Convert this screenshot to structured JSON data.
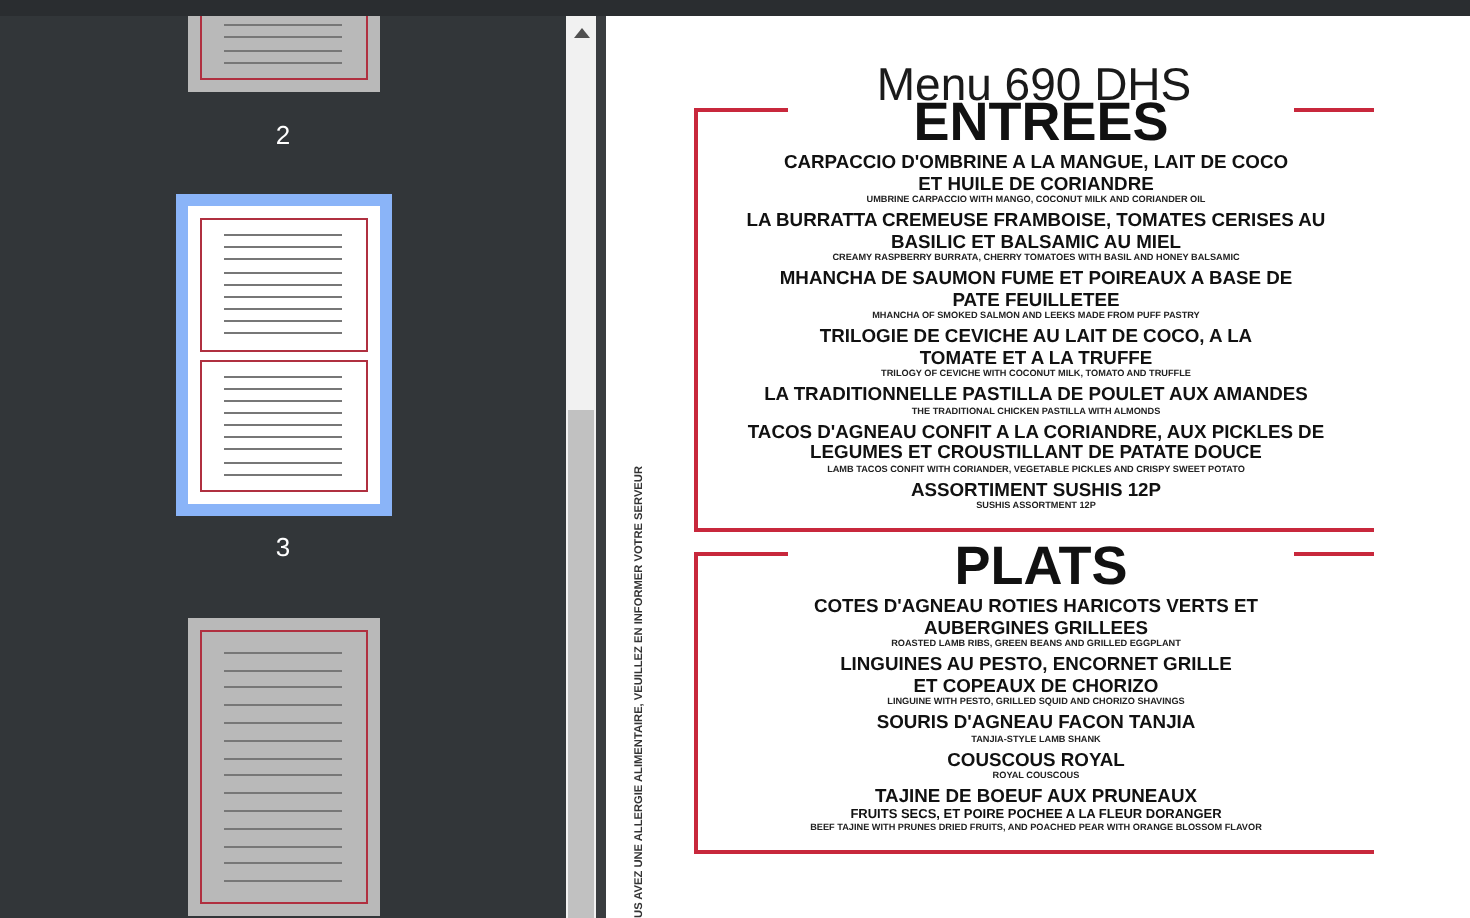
{
  "sidebar": {
    "thumbnails": [
      {
        "page_label": "2",
        "selected": false,
        "kind": "menu"
      },
      {
        "page_label": "3",
        "selected": true,
        "kind": "menu"
      },
      {
        "selected": false,
        "kind": "desserts"
      }
    ]
  },
  "page": {
    "title": "Menu 690 DHS",
    "side_note": "US AVEZ UNE ALLERGIE ALIMENTAIRE, VEUILLEZ EN INFORMER VOTRE SERVEUR",
    "sections": [
      {
        "heading": "ENTREES",
        "items": [
          {
            "name_lines": [
              "CARPACCIO D'OMBRINE A LA MANGUE, LAIT DE COCO",
              "ET HUILE DE CORIANDRE"
            ],
            "description": "UMBRINE CARPACCIO WITH MANGO, COCONUT MILK AND CORIANDER OIL"
          },
          {
            "name_lines": [
              "LA BURRATTA CREMEUSE FRAMBOISE, TOMATES CERISES AU",
              "BASILIC ET BALSAMIC AU MIEL"
            ],
            "description": "CREAMY RASPBERRY BURRATA, CHERRY TOMATOES WITH BASIL AND HONEY BALSAMIC"
          },
          {
            "name_lines": [
              "MHANCHA DE SAUMON FUME ET POIREAUX A BASE DE",
              "PATE FEUILLETEE"
            ],
            "description": "MHANCHA OF SMOKED SALMON AND LEEKS MADE FROM PUFF PASTRY"
          },
          {
            "name_lines": [
              "TRILOGIE DE CEVICHE AU LAIT DE COCO, A LA",
              "TOMATE ET A LA TRUFFE"
            ],
            "description": "TRILOGY OF CEVICHE WITH COCONUT MILK, TOMATO AND TRUFFLE"
          },
          {
            "name_lines": [
              "LA TRADITIONNELLE PASTILLA DE POULET AUX AMANDES"
            ],
            "description": "THE TRADITIONAL CHICKEN PASTILLA WITH ALMONDS"
          },
          {
            "name_lines": [
              "TACOS D'AGNEAU CONFIT A LA CORIANDRE, AUX PICKLES DE",
              "LEGUMES ET CROUSTILLANT DE PATATE DOUCE"
            ],
            "description": "LAMB TACOS CONFIT WITH CORIANDER, VEGETABLE PICKLES AND CRISPY SWEET POTATO"
          },
          {
            "name_lines": [
              "ASSORTIMENT SUSHIS 12P"
            ],
            "description": "SUSHIS ASSORTMENT 12P"
          }
        ]
      },
      {
        "heading": "PLATS",
        "items": [
          {
            "name_lines": [
              "COTES D'AGNEAU ROTIES HARICOTS VERTS ET",
              "AUBERGINES GRILLEES"
            ],
            "description": "ROASTED LAMB RIBS, GREEN BEANS AND GRILLED EGGPLANT"
          },
          {
            "name_lines": [
              "LINGUINES AU PESTO, ENCORNET GRILLE",
              "ET COPEAUX DE CHORIZO"
            ],
            "description": "LINGUINE WITH PESTO, GRILLED SQUID AND CHORIZO SHAVINGS"
          },
          {
            "name_lines": [
              "SOURIS D'AGNEAU FACON TANJIA"
            ],
            "description": "TANJIA-STYLE LAMB SHANK"
          },
          {
            "name_lines": [
              "COUSCOUS ROYAL"
            ],
            "description": "ROYAL COUSCOUS"
          },
          {
            "name_lines": [
              "TAJINE DE BOEUF AUX PRUNEAUX"
            ],
            "subtitle": "FRUITS SECS, ET POIRE POCHEE A LA FLEUR DORANGER",
            "description": "BEEF TAJINE WITH PRUNES DRIED FRUITS, AND POACHED PEAR WITH ORANGE BLOSSOM FLAVOR"
          }
        ]
      }
    ]
  }
}
